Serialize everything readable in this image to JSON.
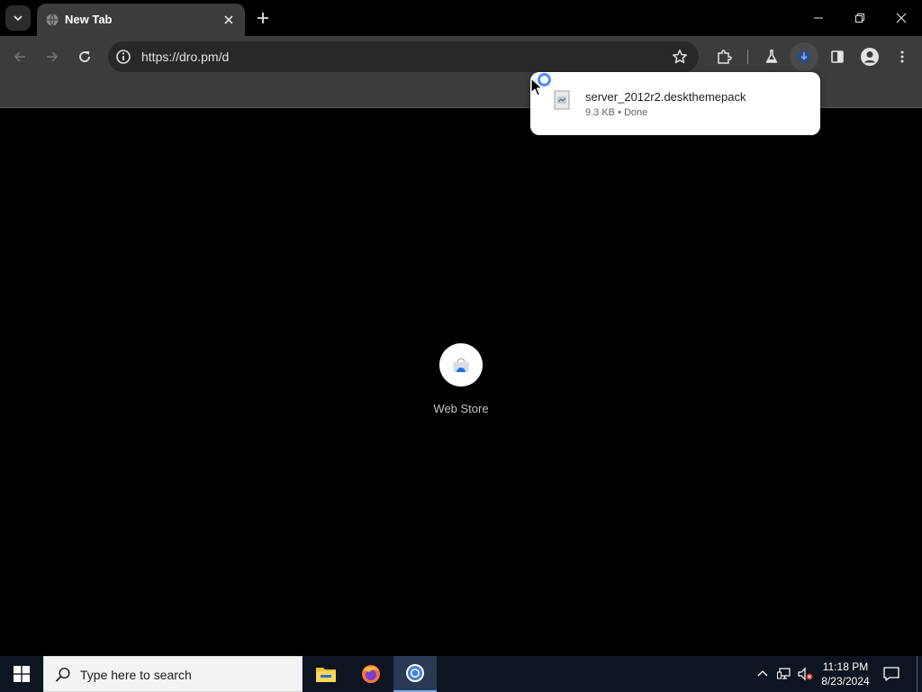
{
  "browser": {
    "tab": {
      "title": "New Tab"
    },
    "omnibox": {
      "url": "https://dro.pm/d"
    }
  },
  "download": {
    "filename": "server_2012r2.deskthemepack",
    "status": "9.3 KB • Done"
  },
  "page": {
    "shortcut": {
      "label": "Web Store"
    }
  },
  "taskbar": {
    "search_placeholder": "Type here to search",
    "clock": {
      "time": "11:18 PM",
      "date": "8/23/2024"
    }
  },
  "colors": {
    "tab_active": "#3c3c3c",
    "toolbar": "#3c3c3c",
    "omnibox": "#282828",
    "page_background": "#000000",
    "accent": "#4c8df6",
    "taskbar": "#0d1520"
  },
  "icons": {
    "tab_search": "chevron-down-icon",
    "favicon": "globe-icon",
    "close": "close-icon",
    "new_tab": "plus-icon",
    "back": "arrow-left-icon",
    "forward": "arrow-right-icon",
    "reload": "reload-icon",
    "site_info": "info-icon",
    "bookmark": "star-icon",
    "extensions": "puzzle-icon",
    "labs": "flask-icon",
    "downloads": "download-icon",
    "side_panel": "side-panel-icon",
    "profile": "avatar-icon",
    "menu": "kebab-menu-icon"
  }
}
